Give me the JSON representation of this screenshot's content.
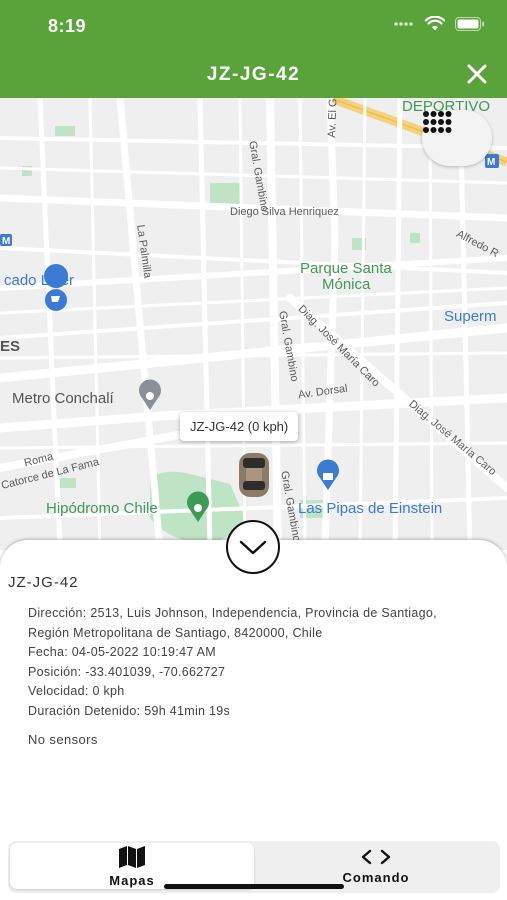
{
  "status_bar": {
    "time": "8:19"
  },
  "nav": {
    "title": "JZ-JG-42"
  },
  "map": {
    "labels": {
      "deportivo": "DEPORTIVO",
      "gral_gambino_top": "Gral. Gambino",
      "av_el_guanaco": "Av. El Guanaco",
      "diego_silva": "Diego Silva Henriquez",
      "alfredo": "Alfredo R",
      "la_palmilla": "La Palmilla",
      "parque_santa_monica_1": "Parque Santa",
      "parque_santa_monica_2": "Mónica",
      "mercado_lider": "cado Lider",
      "superm": "Superm",
      "ces": "ES",
      "diag_jose_maria_caro_1": "Diag. José María Caro",
      "gral_gambino_mid": "Gral. Gambino",
      "av_dorsal": "Av. Dorsal",
      "metro_conchali": "Metro Conchalí",
      "diag_jose_maria_caro_2": "Diag. José María Caro",
      "roma": "Roma",
      "catorce_la_fama": "Catorce de La Fama",
      "hipodromo_chile": "Hipódromo Chile",
      "gral_gambino_low": "Gral. Gambino",
      "las_pipas": "Las Pipas de Einstein"
    },
    "vehicle_tooltip": "JZ-JG-42 (0 kph)"
  },
  "sheet": {
    "vehicle_name": "JZ-JG-42",
    "details": [
      {
        "label": "Dirección:",
        "value": "2513, Luis Johnson, Independencia, Provincia de Santiago, Región Metropolitana de Santiago, 8420000, Chile"
      },
      {
        "label": "Fecha:",
        "value": "04-05-2022 10:19:47 AM"
      },
      {
        "label": "Posición:",
        "value": "-33.401039, -70.662727"
      },
      {
        "label": "Velocidad:",
        "value": "0 kph"
      },
      {
        "label": "Duración Detenido:",
        "value": "59h 41min 19s"
      }
    ],
    "sensors_text": "No sensors"
  },
  "tabs": [
    {
      "label": "Mapas",
      "icon": "map-icon",
      "active": true
    },
    {
      "label": "Comando",
      "icon": "code-icon",
      "active": false
    }
  ],
  "colors": {
    "header_green": "#5aa23a",
    "park_green": "#3f9a55",
    "poi_blue": "#3b7bd6"
  }
}
